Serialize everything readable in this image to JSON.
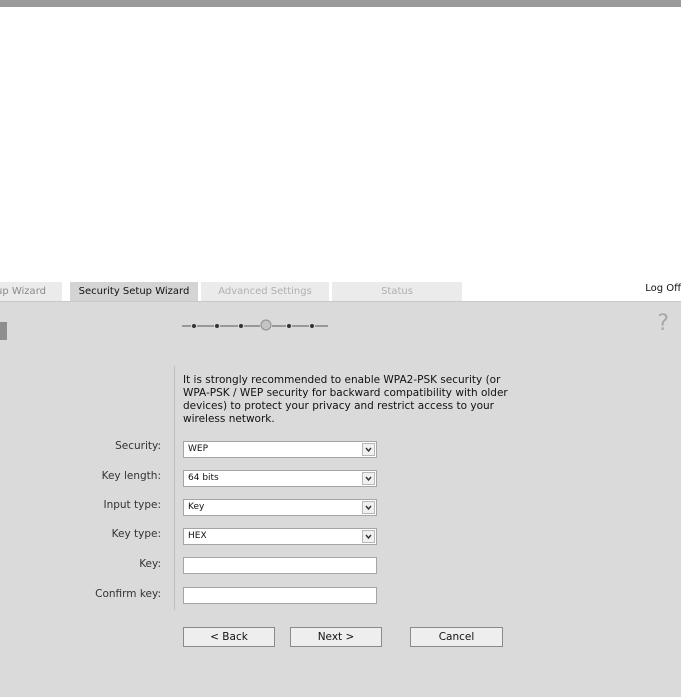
{
  "tabs": {
    "setup": "up Wizard",
    "security": "Security Setup Wizard",
    "advanced": "Advanced Settings",
    "status": "Status"
  },
  "header": {
    "logoff": "Log Off"
  },
  "wizard": {
    "intro": "It is strongly recommended to enable WPA2-PSK security (or WPA-PSK / WEP security for backward compatibility with older devices) to protect your privacy and restrict access to your wireless network.",
    "help_symbol": "?",
    "progress": {
      "total_steps": 6,
      "current_step": 4
    }
  },
  "form": {
    "security": {
      "label": "Security:",
      "value": "WEP"
    },
    "key_length": {
      "label": "Key length:",
      "value": "64 bits"
    },
    "input_type": {
      "label": "Input type:",
      "value": "Key"
    },
    "key_type": {
      "label": "Key type:",
      "value": "HEX"
    },
    "key": {
      "label": "Key:",
      "value": ""
    },
    "confirm_key": {
      "label": "Confirm key:",
      "value": ""
    }
  },
  "buttons": {
    "back": "< Back",
    "next": "Next >",
    "cancel": "Cancel"
  },
  "icons": {
    "dropdown": "chevron-down-icon",
    "help": "question-mark-icon"
  }
}
